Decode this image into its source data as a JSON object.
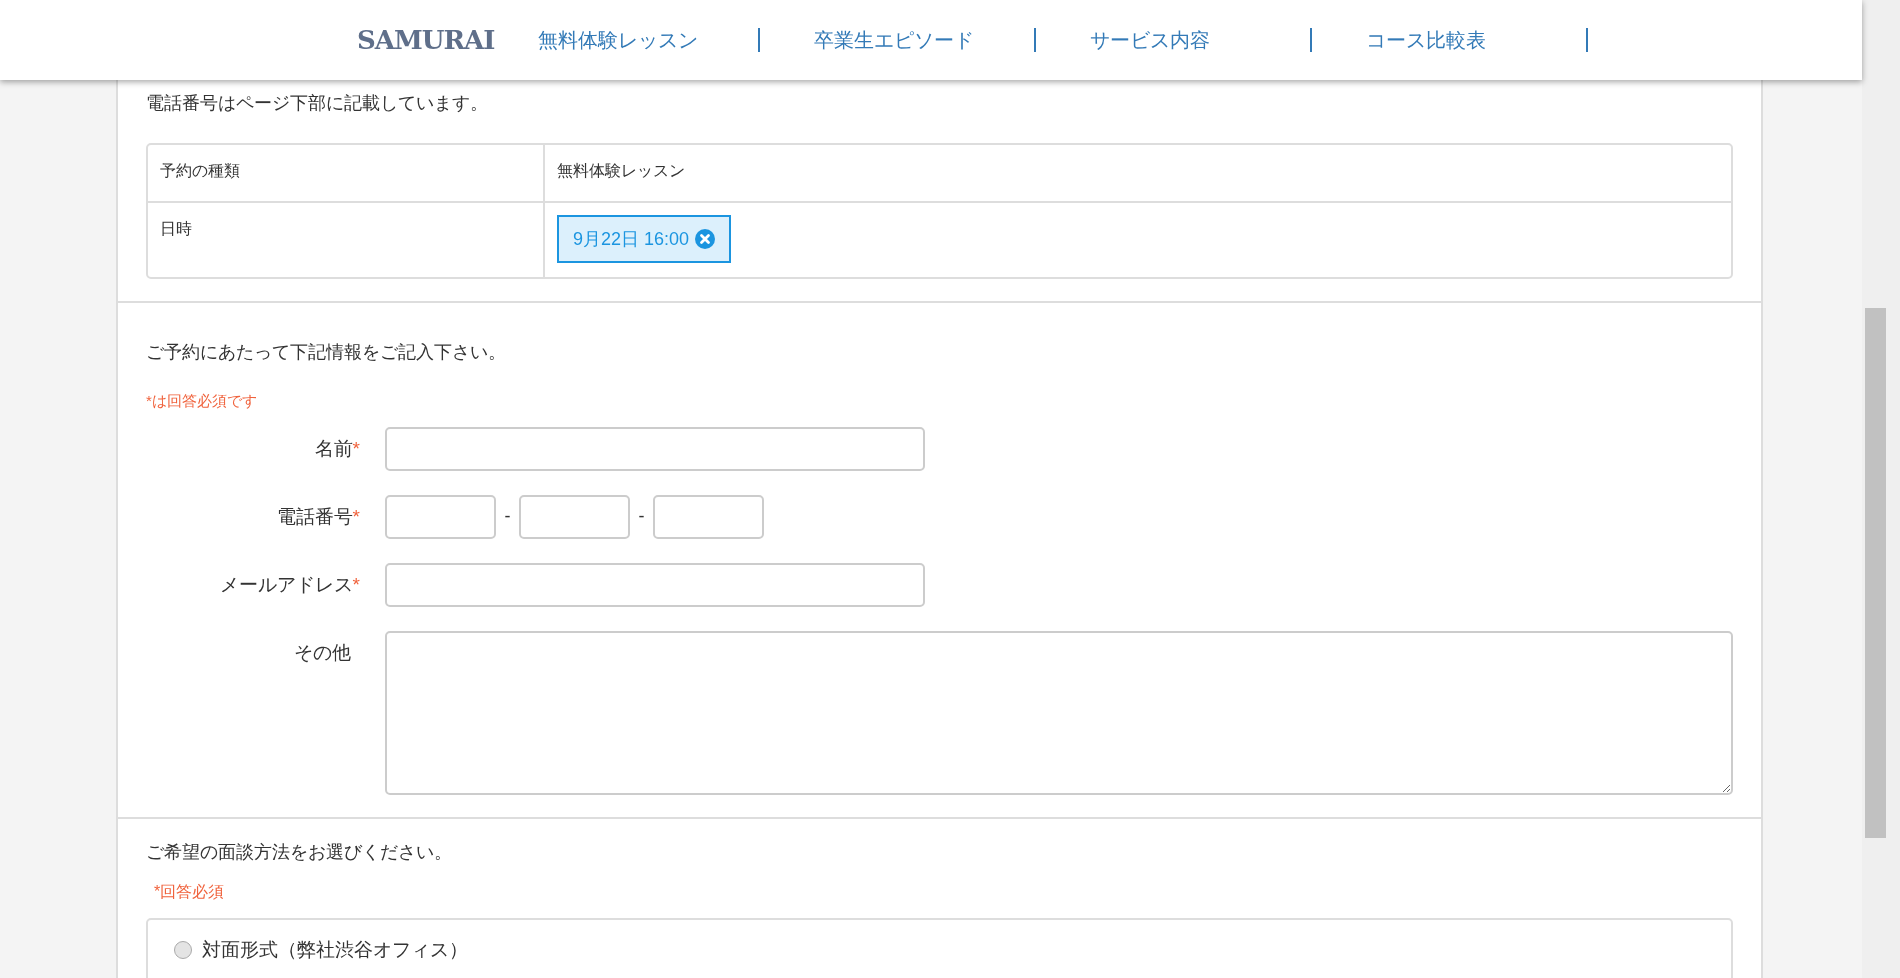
{
  "header": {
    "logo": "SAMURAI",
    "nav": [
      "無料体験レッスン",
      "卒業生エピソード",
      "サービス内容",
      "コース比較表"
    ]
  },
  "intro": "電話番号はページ下部に記載しています。",
  "reservation": {
    "rows": [
      {
        "label": "予約の種類",
        "kind": "text",
        "value": "無料体験レッスン"
      },
      {
        "label": "日時",
        "kind": "tag",
        "value": "9月22日 16:00"
      }
    ]
  },
  "form": {
    "lead": "ご予約にあたって下記情報をご記入下さい。",
    "required_note": "*は回答必須です",
    "required_mark": "*",
    "fields": [
      {
        "label": "名前",
        "required": true,
        "kind": "text"
      },
      {
        "label": "電話番号",
        "required": true,
        "kind": "phone",
        "separators": [
          "-",
          "-"
        ]
      },
      {
        "label": "メールアドレス",
        "required": true,
        "kind": "text"
      },
      {
        "label": "その他",
        "required": false,
        "kind": "textarea"
      }
    ]
  },
  "interview": {
    "lead": "ご希望の面談方法をお選びください。",
    "required_note": "*回答必須",
    "options": [
      {
        "label": "対面形式（弊社渋谷オフィス）",
        "selected": false
      }
    ]
  }
}
